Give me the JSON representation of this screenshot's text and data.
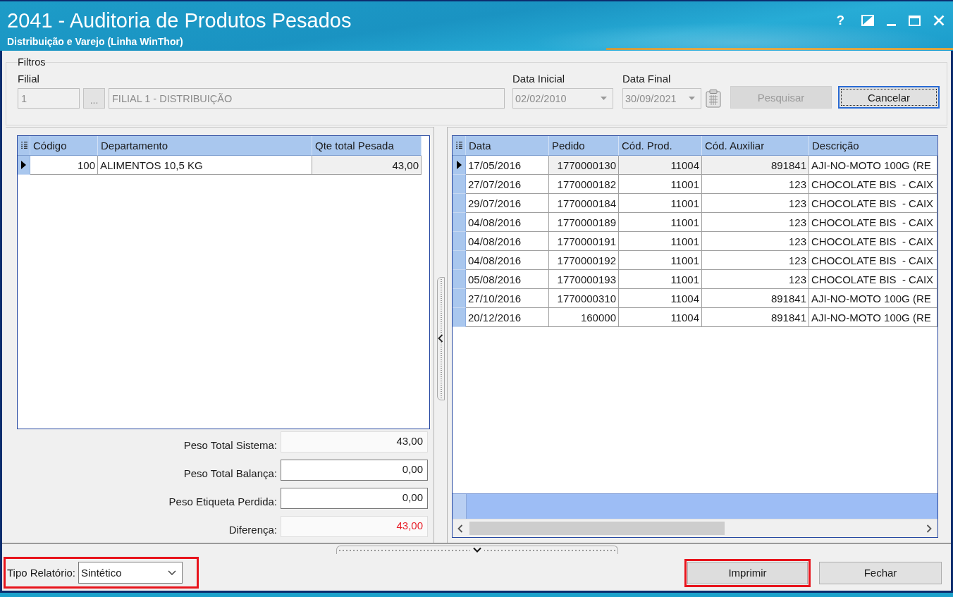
{
  "window": {
    "title": "2041 - Auditoria de Produtos Pesados",
    "subtitle": "Distribuição e Varejo (Linha WinThor)",
    "controls": [
      {
        "kind": "help",
        "label": "?"
      },
      {
        "kind": "split"
      },
      {
        "kind": "minimize"
      },
      {
        "kind": "maximize"
      },
      {
        "kind": "close"
      }
    ]
  },
  "filters": {
    "title": "Filtros",
    "filial": {
      "label": "Filial",
      "code": "1",
      "browse_label": "...",
      "name": "FILIAL 1 - DISTRIBUIÇÃO",
      "disabled": true
    },
    "dates": [
      {
        "label": "Data Inicial",
        "value": "02/02/2010",
        "disabled": true,
        "calendar": false
      },
      {
        "label": "Data Final",
        "value": "30/09/2021",
        "disabled": true,
        "calendar": true
      }
    ],
    "buttons": [
      {
        "label": "Pesquisar",
        "disabled": true,
        "focused": false
      },
      {
        "label": "Cancelar",
        "disabled": false,
        "focused": true
      }
    ]
  },
  "departments": {
    "columns": [
      {
        "label": "Código",
        "readonly": false
      },
      {
        "label": "Departamento",
        "readonly": false
      },
      {
        "label": "Qte total Pesada",
        "readonly": true
      }
    ],
    "rows": [
      {
        "selected": true,
        "cells": [
          "100",
          "ALIMENTOS 10,5 KG",
          "43,00"
        ]
      }
    ]
  },
  "totals": [
    {
      "label": "Peso Total Sistema:",
      "value": "43,00",
      "editable": false,
      "warning": false
    },
    {
      "label": "Peso Total Balança:",
      "value": "0,00",
      "editable": true,
      "warning": false
    },
    {
      "label": "Peso Etiqueta Perdida:",
      "value": "0,00",
      "editable": true,
      "warning": false
    },
    {
      "label": "Diferença:",
      "value": "43,00",
      "editable": false,
      "warning": true
    }
  ],
  "orders": {
    "columns": [
      {
        "label": "Data",
        "readonly": false
      },
      {
        "label": "Pedido",
        "readonly": true
      },
      {
        "label": "Cód. Prod.",
        "readonly": true
      },
      {
        "label": "Cód. Auxiliar",
        "readonly": true
      },
      {
        "label": "Descrição",
        "readonly": false
      }
    ],
    "rows": [
      {
        "selected": true,
        "cells": [
          "17/05/2016",
          "1770000130",
          "11004",
          "891841",
          "AJI-NO-MOTO 100G (RE"
        ]
      },
      {
        "selected": false,
        "cells": [
          "27/07/2016",
          "1770000182",
          "11001",
          "123",
          "CHOCOLATE BIS  - CAIX"
        ]
      },
      {
        "selected": false,
        "cells": [
          "29/07/2016",
          "1770000184",
          "11001",
          "123",
          "CHOCOLATE BIS  - CAIX"
        ]
      },
      {
        "selected": false,
        "cells": [
          "04/08/2016",
          "1770000189",
          "11001",
          "123",
          "CHOCOLATE BIS  - CAIX"
        ]
      },
      {
        "selected": false,
        "cells": [
          "04/08/2016",
          "1770000191",
          "11001",
          "123",
          "CHOCOLATE BIS  - CAIX"
        ]
      },
      {
        "selected": false,
        "cells": [
          "04/08/2016",
          "1770000192",
          "11001",
          "123",
          "CHOCOLATE BIS  - CAIX"
        ]
      },
      {
        "selected": false,
        "cells": [
          "05/08/2016",
          "1770000193",
          "11001",
          "123",
          "CHOCOLATE BIS  - CAIX"
        ]
      },
      {
        "selected": false,
        "cells": [
          "27/10/2016",
          "1770000310",
          "11004",
          "891841",
          "AJI-NO-MOTO 100G (RE"
        ]
      },
      {
        "selected": false,
        "cells": [
          "20/12/2016",
          "160000",
          "11004",
          "891841",
          "AJI-NO-MOTO 100G (RE"
        ]
      }
    ]
  },
  "footer": {
    "report_type": {
      "label": "Tipo Relatório:",
      "value": "Sintético",
      "annotated": true
    },
    "buttons": [
      {
        "label": "Imprimir",
        "annotated": true
      },
      {
        "label": "Fechar",
        "annotated": false
      }
    ]
  }
}
